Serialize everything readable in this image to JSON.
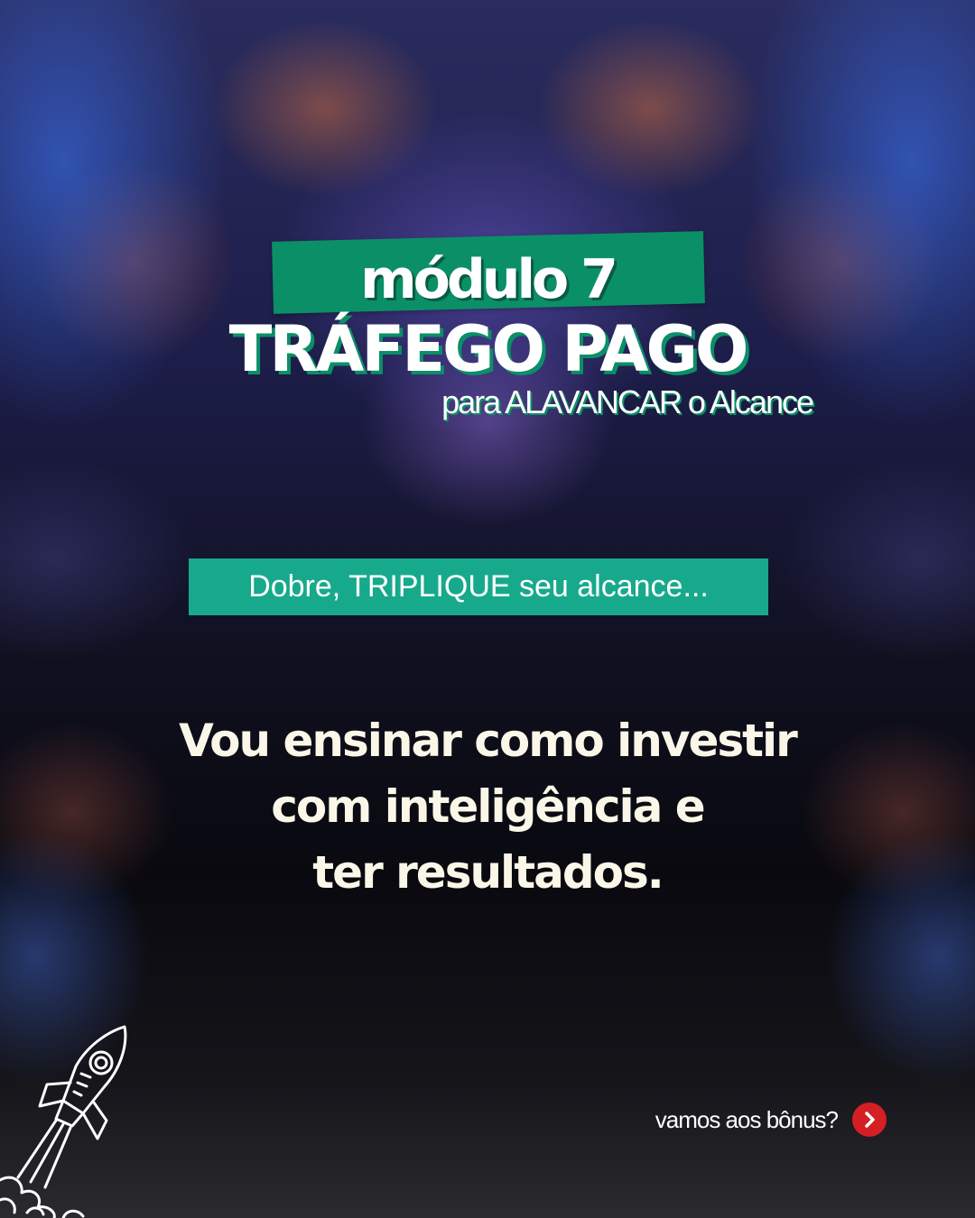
{
  "header": {
    "module_label": "módulo 7",
    "title": "TRÁFEGO PAGO",
    "subtitle": "para ALAVANCAR o Alcance"
  },
  "tag": {
    "text": "Dobre, TRIPLIQUE seu alcance..."
  },
  "body": {
    "lines": [
      "Vou ensinar como investir",
      "com inteligência e",
      "ter resultados."
    ]
  },
  "cta": {
    "label": "vamos aos bônus?",
    "icon": "chevron-right-icon"
  },
  "decoration": {
    "icon": "rocket-icon"
  },
  "colors": {
    "green": "#0b8f67",
    "teal": "#17a98c",
    "accent_red": "#d41f24",
    "text_cream": "#fbf7e8"
  }
}
